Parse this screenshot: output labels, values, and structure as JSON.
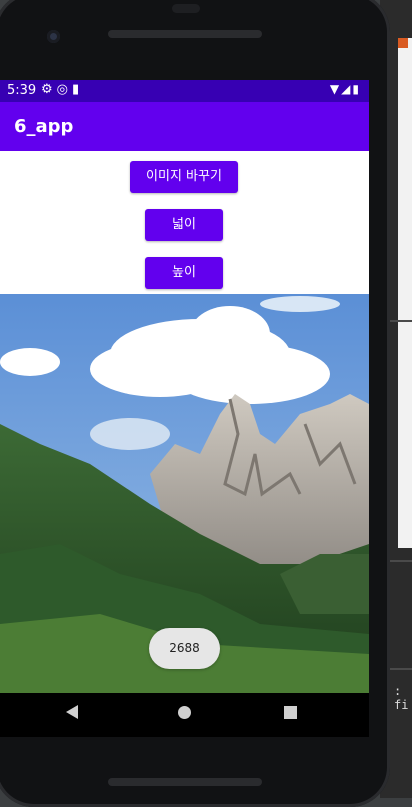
{
  "status_bar": {
    "time": "5:39",
    "left_icons": [
      "gear-icon",
      "sync-icon",
      "sd-card-icon"
    ],
    "right_icons": [
      "wifi-icon",
      "signal-icon",
      "battery-icon"
    ]
  },
  "app_bar": {
    "title": "6_app"
  },
  "buttons": {
    "change_image": "이미지 바꾸기",
    "width": "넓이",
    "height": "높이"
  },
  "image": {
    "description_icon": "mountain-landscape-image"
  },
  "toast": {
    "text": "2688"
  },
  "nav_bar": {
    "icons": [
      "back-icon",
      "home-icon",
      "recents-icon"
    ]
  },
  "ide_side": {
    "partial_label": ": fi"
  },
  "colors": {
    "status_bar": "#3700b3",
    "app_bar": "#6200ee",
    "button": "#6200ee"
  }
}
